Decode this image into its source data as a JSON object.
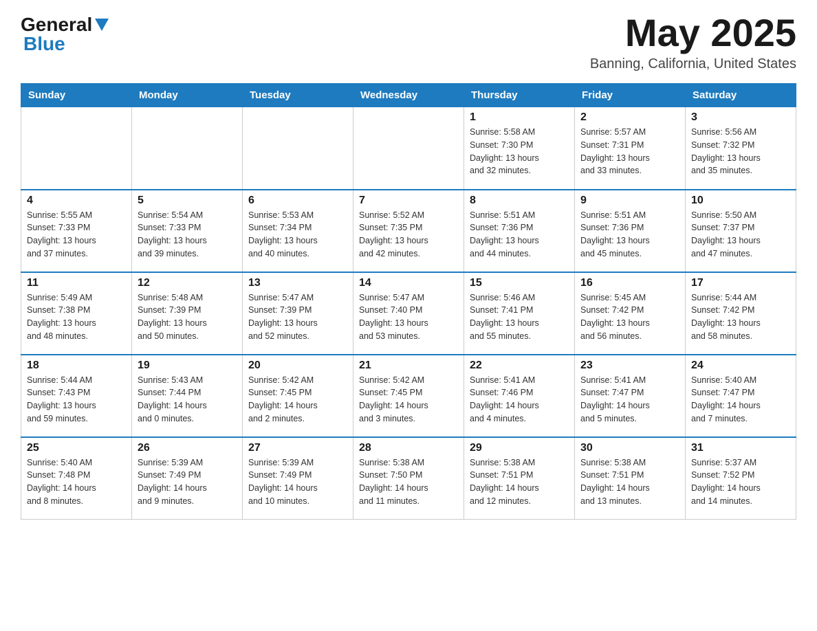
{
  "header": {
    "logo_general": "General",
    "logo_blue": "Blue",
    "month_title": "May 2025",
    "subtitle": "Banning, California, United States"
  },
  "days_of_week": [
    "Sunday",
    "Monday",
    "Tuesday",
    "Wednesday",
    "Thursday",
    "Friday",
    "Saturday"
  ],
  "weeks": [
    [
      {
        "day": "",
        "info": ""
      },
      {
        "day": "",
        "info": ""
      },
      {
        "day": "",
        "info": ""
      },
      {
        "day": "",
        "info": ""
      },
      {
        "day": "1",
        "info": "Sunrise: 5:58 AM\nSunset: 7:30 PM\nDaylight: 13 hours\nand 32 minutes."
      },
      {
        "day": "2",
        "info": "Sunrise: 5:57 AM\nSunset: 7:31 PM\nDaylight: 13 hours\nand 33 minutes."
      },
      {
        "day": "3",
        "info": "Sunrise: 5:56 AM\nSunset: 7:32 PM\nDaylight: 13 hours\nand 35 minutes."
      }
    ],
    [
      {
        "day": "4",
        "info": "Sunrise: 5:55 AM\nSunset: 7:33 PM\nDaylight: 13 hours\nand 37 minutes."
      },
      {
        "day": "5",
        "info": "Sunrise: 5:54 AM\nSunset: 7:33 PM\nDaylight: 13 hours\nand 39 minutes."
      },
      {
        "day": "6",
        "info": "Sunrise: 5:53 AM\nSunset: 7:34 PM\nDaylight: 13 hours\nand 40 minutes."
      },
      {
        "day": "7",
        "info": "Sunrise: 5:52 AM\nSunset: 7:35 PM\nDaylight: 13 hours\nand 42 minutes."
      },
      {
        "day": "8",
        "info": "Sunrise: 5:51 AM\nSunset: 7:36 PM\nDaylight: 13 hours\nand 44 minutes."
      },
      {
        "day": "9",
        "info": "Sunrise: 5:51 AM\nSunset: 7:36 PM\nDaylight: 13 hours\nand 45 minutes."
      },
      {
        "day": "10",
        "info": "Sunrise: 5:50 AM\nSunset: 7:37 PM\nDaylight: 13 hours\nand 47 minutes."
      }
    ],
    [
      {
        "day": "11",
        "info": "Sunrise: 5:49 AM\nSunset: 7:38 PM\nDaylight: 13 hours\nand 48 minutes."
      },
      {
        "day": "12",
        "info": "Sunrise: 5:48 AM\nSunset: 7:39 PM\nDaylight: 13 hours\nand 50 minutes."
      },
      {
        "day": "13",
        "info": "Sunrise: 5:47 AM\nSunset: 7:39 PM\nDaylight: 13 hours\nand 52 minutes."
      },
      {
        "day": "14",
        "info": "Sunrise: 5:47 AM\nSunset: 7:40 PM\nDaylight: 13 hours\nand 53 minutes."
      },
      {
        "day": "15",
        "info": "Sunrise: 5:46 AM\nSunset: 7:41 PM\nDaylight: 13 hours\nand 55 minutes."
      },
      {
        "day": "16",
        "info": "Sunrise: 5:45 AM\nSunset: 7:42 PM\nDaylight: 13 hours\nand 56 minutes."
      },
      {
        "day": "17",
        "info": "Sunrise: 5:44 AM\nSunset: 7:42 PM\nDaylight: 13 hours\nand 58 minutes."
      }
    ],
    [
      {
        "day": "18",
        "info": "Sunrise: 5:44 AM\nSunset: 7:43 PM\nDaylight: 13 hours\nand 59 minutes."
      },
      {
        "day": "19",
        "info": "Sunrise: 5:43 AM\nSunset: 7:44 PM\nDaylight: 14 hours\nand 0 minutes."
      },
      {
        "day": "20",
        "info": "Sunrise: 5:42 AM\nSunset: 7:45 PM\nDaylight: 14 hours\nand 2 minutes."
      },
      {
        "day": "21",
        "info": "Sunrise: 5:42 AM\nSunset: 7:45 PM\nDaylight: 14 hours\nand 3 minutes."
      },
      {
        "day": "22",
        "info": "Sunrise: 5:41 AM\nSunset: 7:46 PM\nDaylight: 14 hours\nand 4 minutes."
      },
      {
        "day": "23",
        "info": "Sunrise: 5:41 AM\nSunset: 7:47 PM\nDaylight: 14 hours\nand 5 minutes."
      },
      {
        "day": "24",
        "info": "Sunrise: 5:40 AM\nSunset: 7:47 PM\nDaylight: 14 hours\nand 7 minutes."
      }
    ],
    [
      {
        "day": "25",
        "info": "Sunrise: 5:40 AM\nSunset: 7:48 PM\nDaylight: 14 hours\nand 8 minutes."
      },
      {
        "day": "26",
        "info": "Sunrise: 5:39 AM\nSunset: 7:49 PM\nDaylight: 14 hours\nand 9 minutes."
      },
      {
        "day": "27",
        "info": "Sunrise: 5:39 AM\nSunset: 7:49 PM\nDaylight: 14 hours\nand 10 minutes."
      },
      {
        "day": "28",
        "info": "Sunrise: 5:38 AM\nSunset: 7:50 PM\nDaylight: 14 hours\nand 11 minutes."
      },
      {
        "day": "29",
        "info": "Sunrise: 5:38 AM\nSunset: 7:51 PM\nDaylight: 14 hours\nand 12 minutes."
      },
      {
        "day": "30",
        "info": "Sunrise: 5:38 AM\nSunset: 7:51 PM\nDaylight: 14 hours\nand 13 minutes."
      },
      {
        "day": "31",
        "info": "Sunrise: 5:37 AM\nSunset: 7:52 PM\nDaylight: 14 hours\nand 14 minutes."
      }
    ]
  ]
}
